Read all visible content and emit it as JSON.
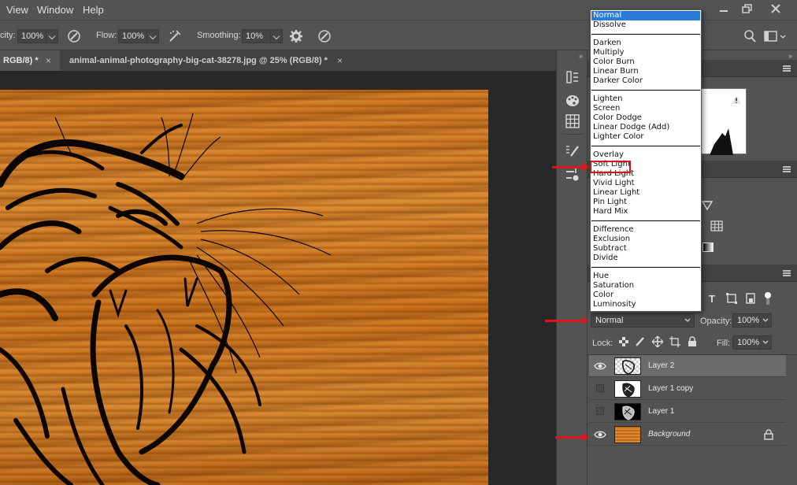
{
  "menubar": {
    "items": [
      "View",
      "Window",
      "Help"
    ]
  },
  "options": {
    "opacity_label": "city:",
    "opacity_value": "100%",
    "flow_label": "Flow:",
    "flow_value": "100%",
    "smoothing_label": "Smoothing:",
    "smoothing_value": "10%"
  },
  "tabs": [
    {
      "label": "RGB/8) *",
      "close": "×"
    },
    {
      "label": "animal-animal-photography-big-cat-38278.jpg @ 25% (RGB/8) *",
      "close": "×"
    }
  ],
  "blend_modes": {
    "groups": [
      [
        "Normal",
        "Dissolve"
      ],
      [
        "Darken",
        "Multiply",
        "Color Burn",
        "Linear Burn",
        "Darker Color"
      ],
      [
        "Lighten",
        "Screen",
        "Color Dodge",
        "Linear Dodge (Add)",
        "Lighter Color"
      ],
      [
        "Overlay",
        "Soft Light",
        "Hard Light",
        "Vivid Light",
        "Linear Light",
        "Pin Light",
        "Hard Mix"
      ],
      [
        "Difference",
        "Exclusion",
        "Subtract",
        "Divide"
      ],
      [
        "Hue",
        "Saturation",
        "Color",
        "Luminosity"
      ]
    ],
    "selected": "Normal",
    "highlighted": "Soft Light"
  },
  "layers_panel": {
    "blend_value": "Normal",
    "opacity_label": "Opacity:",
    "opacity_value": "100%",
    "lock_label": "Lock:",
    "fill_label": "Fill:",
    "fill_value": "100%",
    "layers": [
      {
        "name": "Layer 2",
        "visible": true,
        "active": true
      },
      {
        "name": "Layer 1 copy",
        "visible": false,
        "active": false
      },
      {
        "name": "Layer 1",
        "visible": false,
        "active": false
      },
      {
        "name": "Background",
        "visible": true,
        "active": false,
        "locked": true
      }
    ]
  },
  "colors": {
    "accent_red": "#e0141a",
    "selection_blue": "#2a7bd6",
    "wood": "#c9711e"
  }
}
